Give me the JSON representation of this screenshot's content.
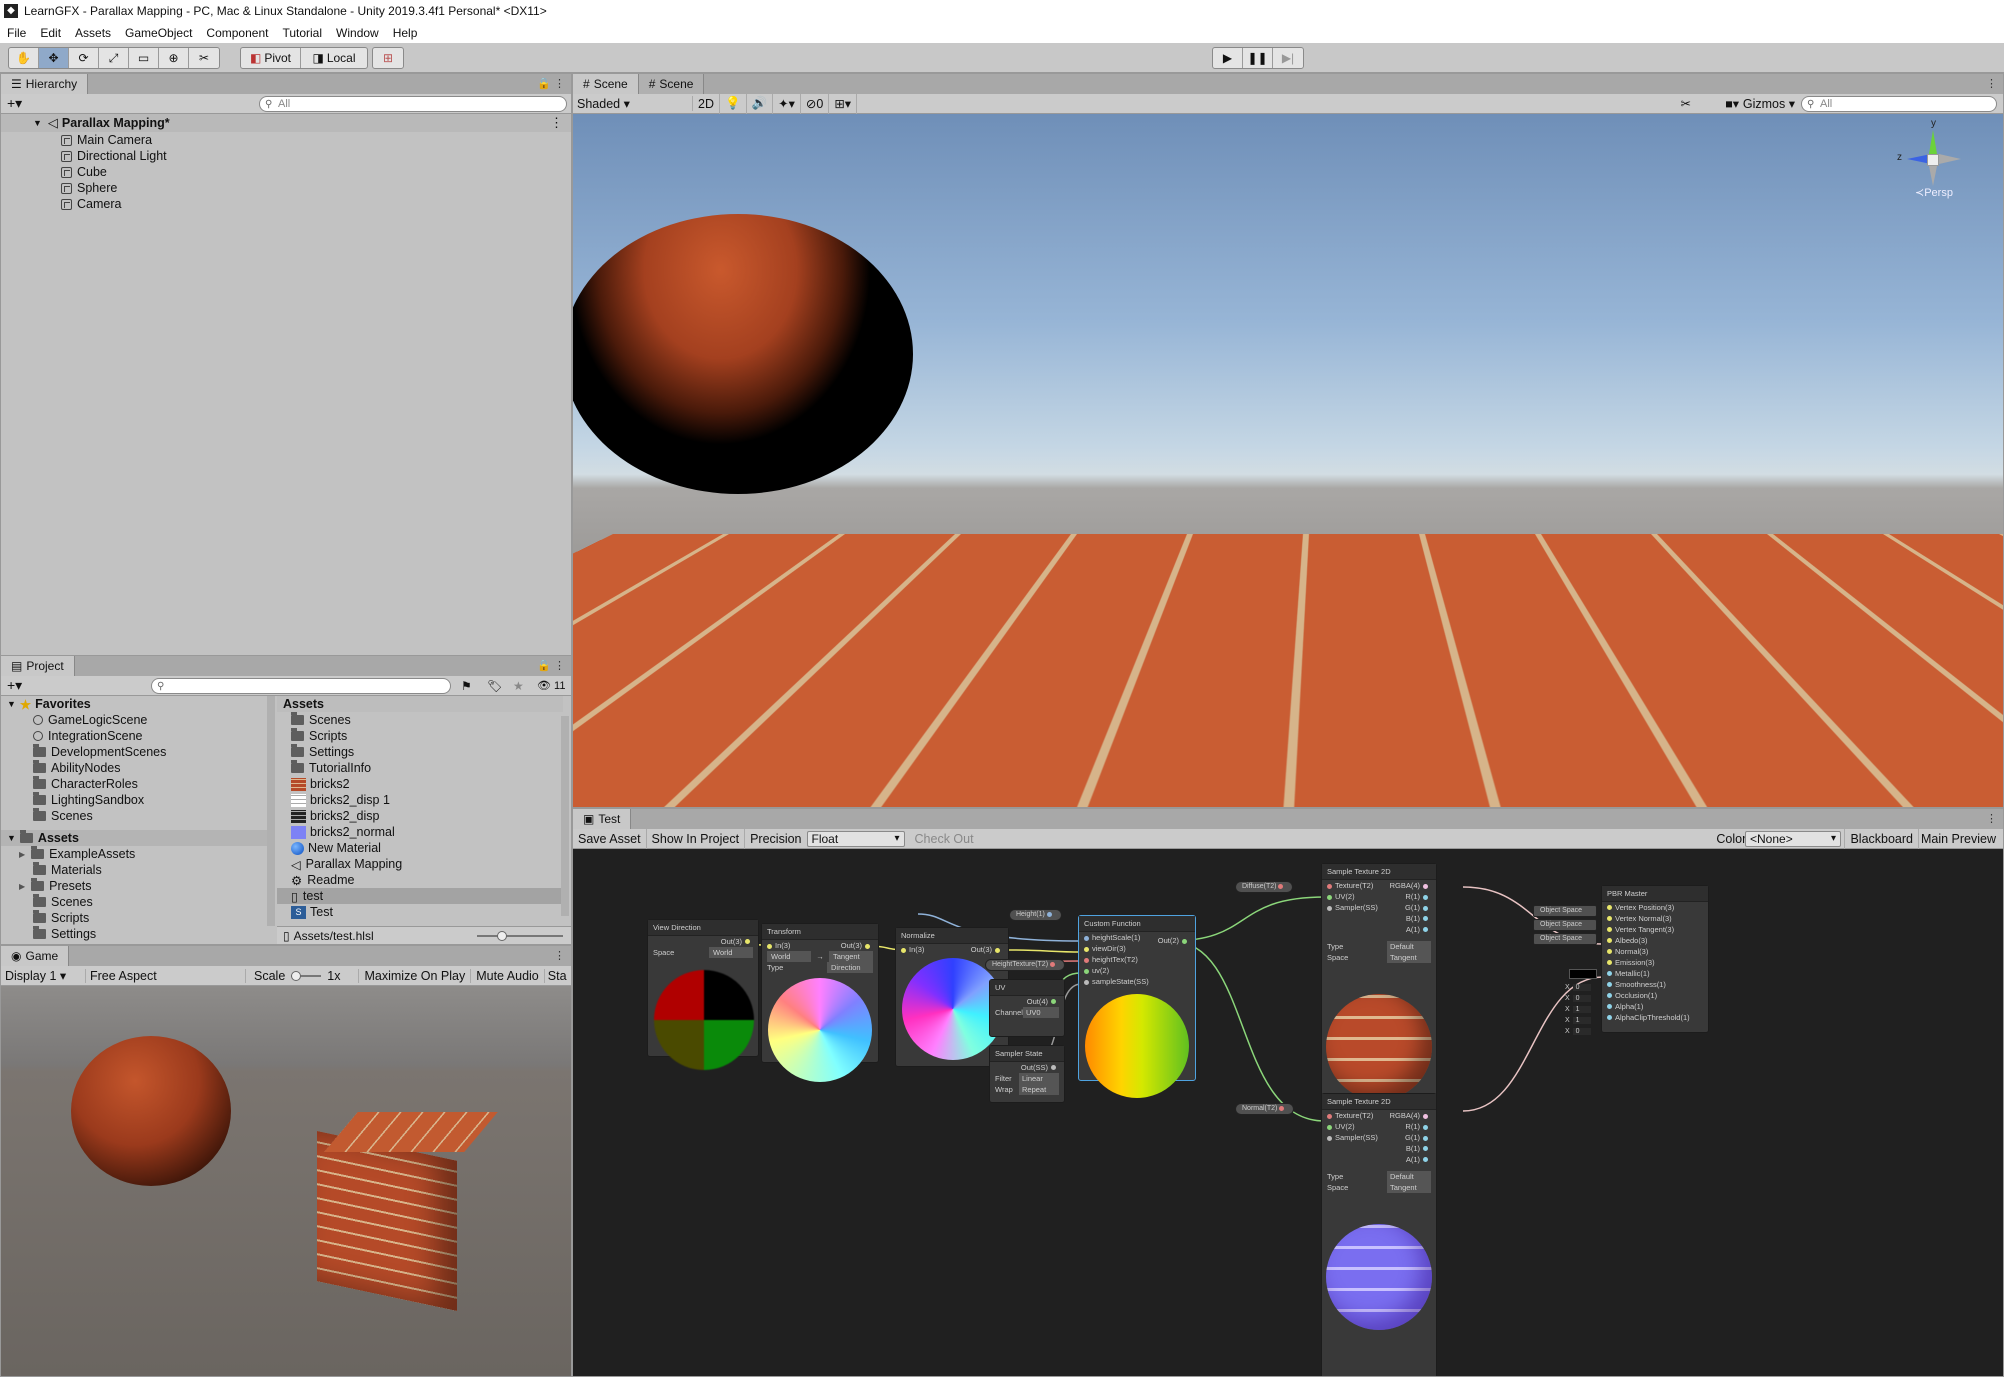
{
  "window": {
    "title": "LearnGFX - Parallax Mapping - PC, Mac & Linux Standalone - Unity 2019.3.4f1 Personal* <DX11>"
  },
  "menu": [
    "File",
    "Edit",
    "Assets",
    "GameObject",
    "Component",
    "Tutorial",
    "Window",
    "Help"
  ],
  "toolbar": {
    "pivot": "Pivot",
    "local": "Local"
  },
  "hierarchy": {
    "tab": "Hierarchy",
    "search_placeholder": "All",
    "scene_name": "Parallax Mapping*",
    "items": [
      "Main Camera",
      "Directional Light",
      "Cube",
      "Sphere",
      "Camera"
    ]
  },
  "scene_view": {
    "tabs": [
      "Scene",
      "Scene"
    ],
    "shading": "Shaded",
    "mode_2d": "2D",
    "hidden_count": "0",
    "gizmos": "Gizmos",
    "search_placeholder": "All",
    "persp_label": "Persp",
    "axis_y": "y",
    "axis_z": "z"
  },
  "project": {
    "tab": "Project",
    "visible_count": "11",
    "favorites_label": "Favorites",
    "favorites": [
      "GameLogicScene",
      "IntegrationScene",
      "DevelopmentScenes",
      "AbilityNodes",
      "CharacterRoles",
      "LightingSandbox",
      "Scenes"
    ],
    "assets_tree_label": "Assets",
    "assets_tree": [
      "ExampleAssets",
      "Materials",
      "Presets",
      "Scenes",
      "Scripts",
      "Settings"
    ],
    "assets_header": "Assets",
    "assets": [
      {
        "name": "Scenes",
        "kind": "folder"
      },
      {
        "name": "Scripts",
        "kind": "folder"
      },
      {
        "name": "Settings",
        "kind": "folder"
      },
      {
        "name": "TutorialInfo",
        "kind": "folder"
      },
      {
        "name": "bricks2",
        "kind": "tex-red"
      },
      {
        "name": "bricks2_disp 1",
        "kind": "tex-white"
      },
      {
        "name": "bricks2_disp",
        "kind": "tex-dark"
      },
      {
        "name": "bricks2_normal",
        "kind": "tex-blue"
      },
      {
        "name": "New Material",
        "kind": "material"
      },
      {
        "name": "Parallax Mapping",
        "kind": "scene"
      },
      {
        "name": "Readme",
        "kind": "readme"
      },
      {
        "name": "test",
        "kind": "file",
        "selected": true
      },
      {
        "name": "Test",
        "kind": "shader"
      }
    ],
    "status_path": "Assets/test.hlsl"
  },
  "game_view": {
    "tab": "Game",
    "display": "Display 1",
    "aspect": "Free Aspect",
    "scale_label": "Scale",
    "scale_value": "1x",
    "maximize": "Maximize On Play",
    "mute": "Mute Audio",
    "stats": "Sta"
  },
  "shader_graph": {
    "tab": "Test",
    "save": "Save Asset",
    "show_in_project": "Show In Project",
    "precision_label": "Precision",
    "precision_value": "Float",
    "check_out": "Check Out",
    "color_mode_label": "Color Mode",
    "color_mode_value": "<None>",
    "blackboard": "Blackboard",
    "main_preview": "Main Preview",
    "nodes": {
      "view_direction": {
        "title": "View Direction",
        "out": "Out(3)",
        "space_label": "Space",
        "space_value": "World"
      },
      "transform": {
        "title": "Transform",
        "in": "In(3)",
        "out": "Out(3)",
        "from": "World",
        "to": "Tangent",
        "type_label": "Type",
        "type_value": "Direction"
      },
      "normalize": {
        "title": "Normalize",
        "in": "In(3)",
        "out": "Out(3)"
      },
      "uv": {
        "title": "UV",
        "out": "Out(4)",
        "channel_label": "Channel",
        "channel_value": "UV0"
      },
      "sampler_state": {
        "title": "Sampler State",
        "out": "Out(SS)",
        "filter_label": "Filter",
        "filter_value": "Linear",
        "wrap_label": "Wrap",
        "wrap_value": "Repeat"
      },
      "custom_function": {
        "title": "Custom Function",
        "inputs": [
          "heightScale(1)",
          "viewDir(3)",
          "heightTex(T2)",
          "uv(2)",
          "sampleState(SS)"
        ],
        "out": "Out(2)"
      },
      "sample_tex_1": {
        "title": "Sample Texture 2D",
        "inputs": [
          "Texture(T2)",
          "UV(2)",
          "Sampler(SS)"
        ],
        "outputs": [
          "RGBA(4)",
          "R(1)",
          "G(1)",
          "B(1)",
          "A(1)"
        ],
        "type_label": "Type",
        "type_value": "Default",
        "space_label": "Space",
        "space_value": "Tangent"
      },
      "sample_tex_2": {
        "title": "Sample Texture 2D",
        "inputs": [
          "Texture(T2)",
          "UV(2)",
          "Sampler(SS)"
        ],
        "outputs": [
          "RGBA(4)",
          "R(1)",
          "G(1)",
          "B(1)",
          "A(1)"
        ],
        "type_label": "Type",
        "type_value": "Default",
        "space_label": "Space",
        "space_value": "Tangent"
      },
      "pbr_master": {
        "title": "PBR Master",
        "inputs": [
          "Vertex Position(3)",
          "Vertex Normal(3)",
          "Vertex Tangent(3)",
          "Albedo(3)",
          "Normal(3)",
          "Emission(3)",
          "Metallic(1)",
          "Smoothness(1)",
          "Occlusion(1)",
          "Alpha(1)",
          "AlphaClipThreshold(1)"
        ],
        "object_space": "Object Space",
        "values": [
          "0",
          "0",
          "1",
          "1",
          "0"
        ],
        "x_label": "X"
      }
    },
    "properties": {
      "height": "Height(1)",
      "height_texture": "HeightTexture(T2)",
      "diffuse": "Diffuse(T2)",
      "normal": "Normal(T2)"
    }
  }
}
